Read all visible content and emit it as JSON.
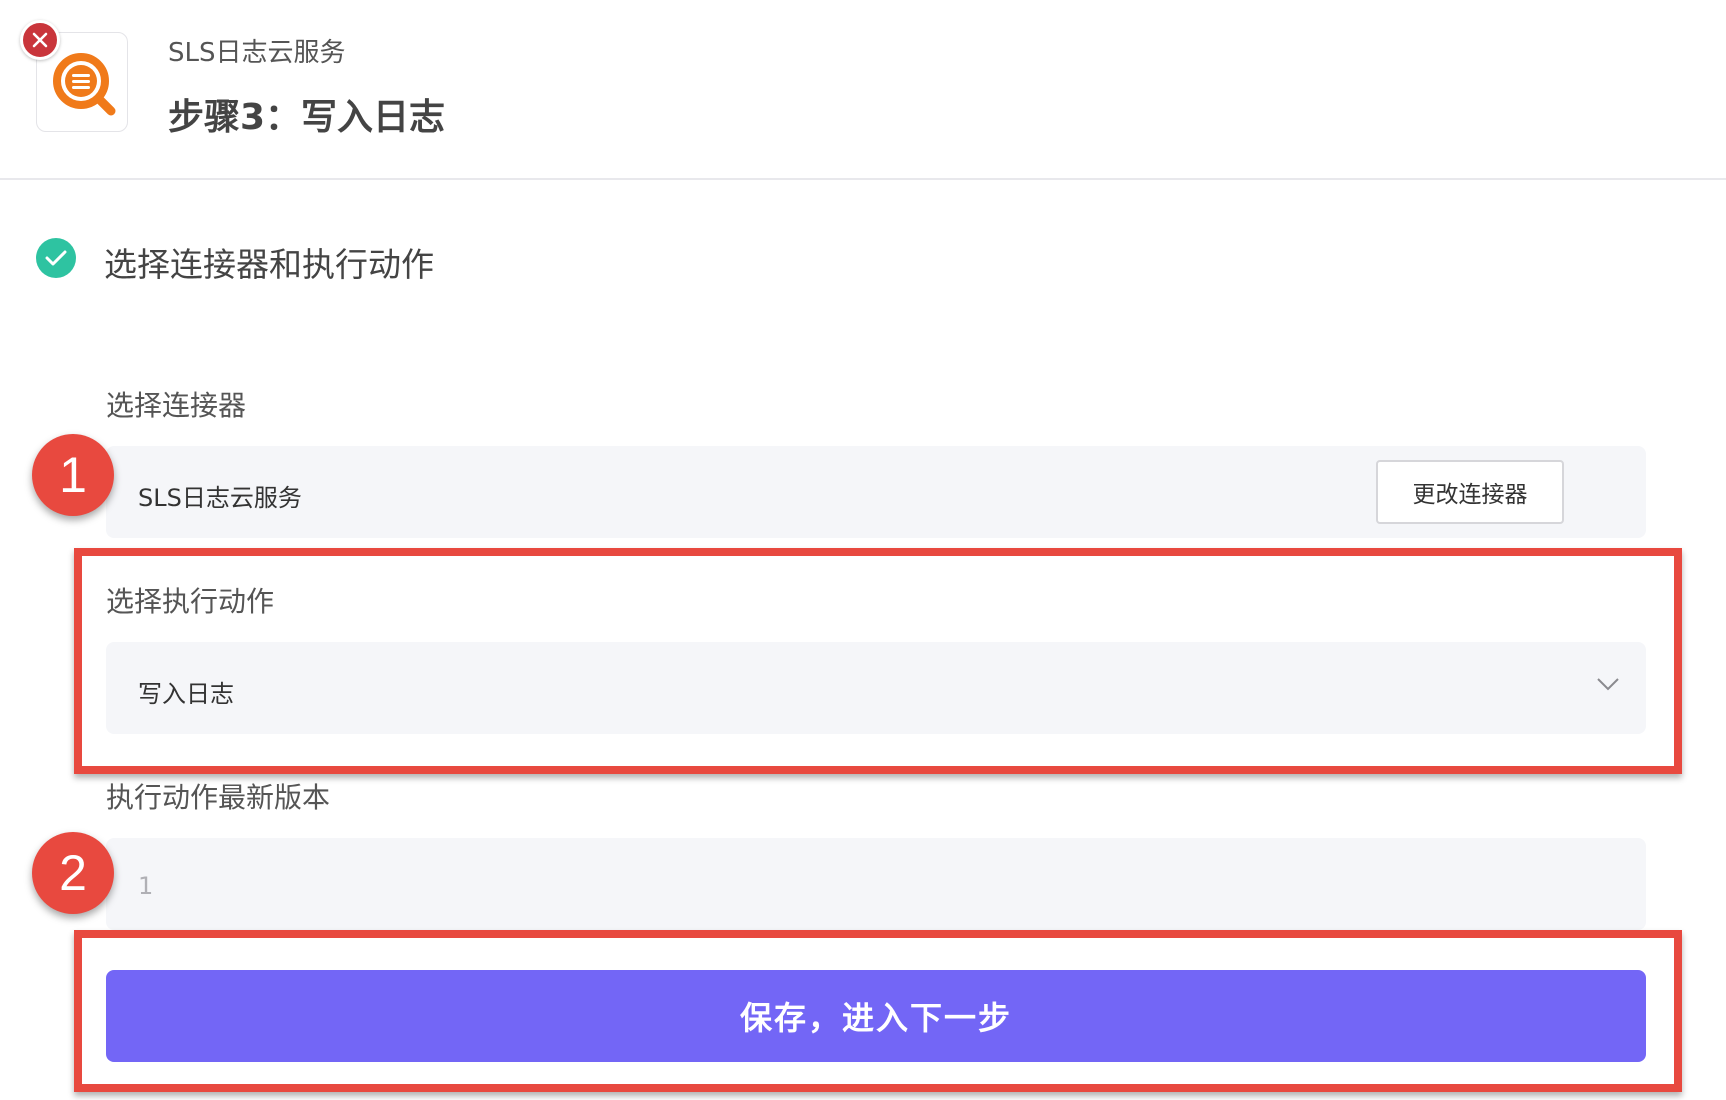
{
  "header": {
    "connector_name": "SLS日志云服务",
    "step_title": "步骤3：写入日志",
    "icons": {
      "app": "log-search-icon",
      "close": "close-icon"
    }
  },
  "step": {
    "label": "选择连接器和执行动作",
    "status_icon": "check-circle-icon"
  },
  "connector_section": {
    "label": "选择连接器",
    "value": "SLS日志云服务",
    "change_button": "更改连接器"
  },
  "action_section": {
    "label": "选择执行动作",
    "selected": "写入日志"
  },
  "version_section": {
    "label": "执行动作最新版本",
    "value": "1"
  },
  "badges": {
    "one": "1",
    "two": "2"
  },
  "submit_button": "保存，进入下一步",
  "colors": {
    "accent": "#7366f6",
    "success": "#2ec3a1",
    "annotation_red": "#e8493f",
    "close_red": "#c9353b",
    "icon_orange": "#f07a1a"
  }
}
